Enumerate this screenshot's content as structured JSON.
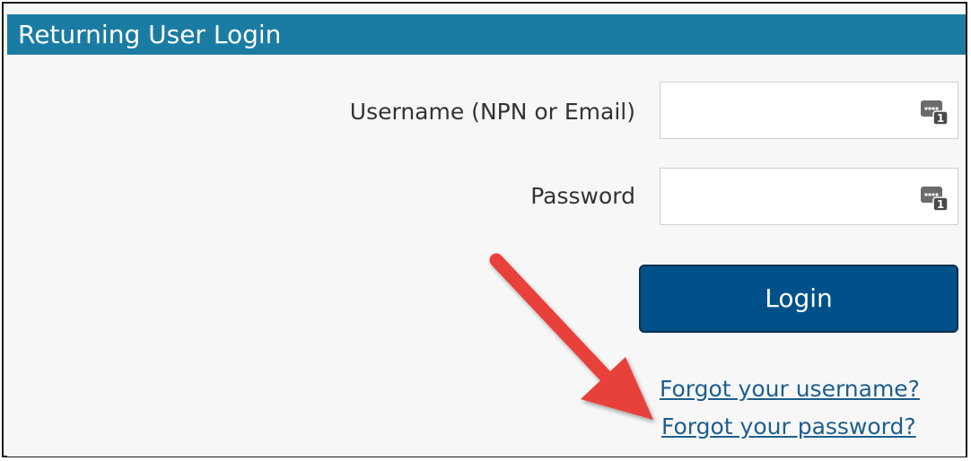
{
  "panel": {
    "title": "Returning User Login",
    "header_color": "#1b7ca3"
  },
  "form": {
    "username_label": "Username (NPN or Email)",
    "username_value": "",
    "password_label": "Password",
    "password_value": "",
    "field_icon": "password-manager-icon",
    "login_button_label": "Login",
    "login_button_color": "#00518a"
  },
  "links": {
    "forgot_username": "Forgot your username?",
    "forgot_password": "Forgot your password?",
    "link_color": "#1e5f8e"
  },
  "annotation": {
    "arrow_color": "#e8403a",
    "arrow_target": "forgot-password-link"
  }
}
